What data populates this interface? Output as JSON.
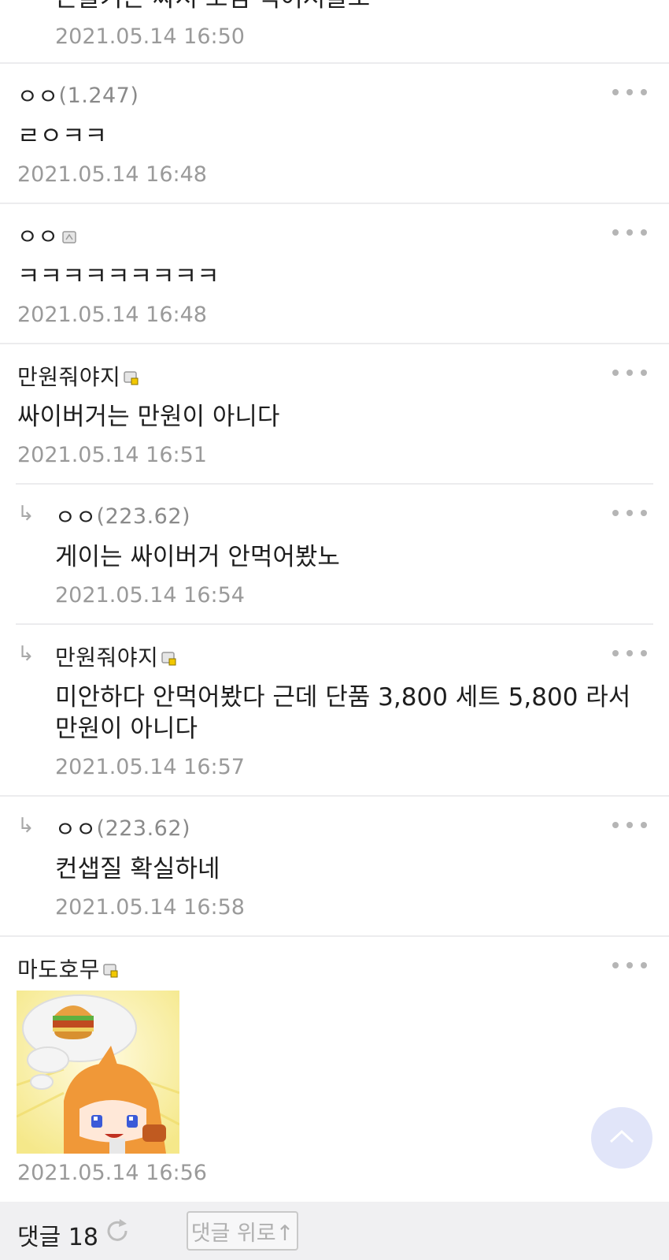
{
  "comments": [
    {
      "nick": "",
      "ip": "",
      "body": "근들기는 싸서 보겸 먹어서들꼬",
      "time": "2021.05.14 16:50",
      "reply": true
    },
    {
      "nick": "ㅇㅇ",
      "ip": "(1.247)",
      "body": "ㄹㅇㅋㅋ",
      "time": "2021.05.14 16:48",
      "reply": false
    },
    {
      "nick": "ㅇㅇ",
      "ip": "",
      "body": "ㅋㅋㅋㅋㅋㅋㅋㅋㅋ",
      "time": "2021.05.14 16:48",
      "reply": false
    },
    {
      "nick": "만원줘야지",
      "ip": "",
      "body": "싸이버거는 만원이 아니다",
      "time": "2021.05.14 16:51",
      "reply": false
    },
    {
      "nick": "ㅇㅇ",
      "ip": "(223.62)",
      "body": "게이는 싸이버거 안먹어봤노",
      "time": "2021.05.14 16:54",
      "reply": true
    },
    {
      "nick": "만원줘야지",
      "ip": "",
      "body": "미안하다 안먹어봤다 근데 단품 3,800 세트 5,800 라서 만원이 아니다",
      "time": "2021.05.14 16:57",
      "reply": true
    },
    {
      "nick": "ㅇㅇ",
      "ip": "(223.62)",
      "body": "컨샙질 확실하네",
      "time": "2021.05.14 16:58",
      "reply": true
    },
    {
      "nick": "마도호무",
      "ip": "",
      "body": "",
      "time": "2021.05.14 16:56",
      "reply": false
    }
  ],
  "icons": {
    "reply": "↳",
    "more": "more-dots-icon",
    "badge_fixed": "fixed-nick-badge-icon",
    "badge_half": "half-fixed-nick-badge-icon"
  },
  "bottom": {
    "count_label": "댓글 18",
    "top_button_label": "댓글 위로↑"
  },
  "colors": {
    "time": "#9a9a9a",
    "divider": "#ececee",
    "bottom_bar": "#f0f0f2",
    "scroll_top": "#dce0f8"
  }
}
